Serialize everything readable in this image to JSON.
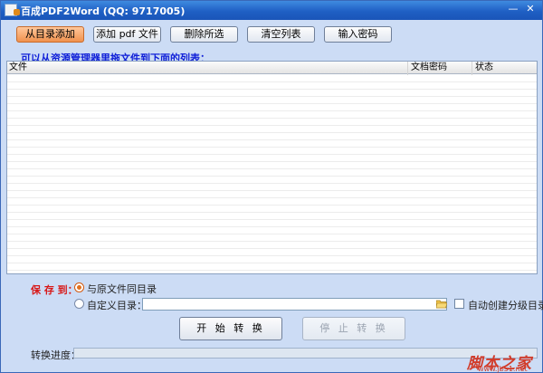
{
  "window": {
    "title": "百成PDF2Word (QQ: 9717005)",
    "minimize_glyph": "—",
    "close_glyph": "✕"
  },
  "toolbar": {
    "buttons": [
      {
        "label": "从目录添加",
        "active": true
      },
      {
        "label": "添加 pdf 文件",
        "active": false
      },
      {
        "label": "删除所选",
        "active": false
      },
      {
        "label": "清空列表",
        "active": false
      },
      {
        "label": "输入密码",
        "active": false
      }
    ]
  },
  "hint": "可以从资源管理器里拖文件到下面的列表：",
  "file_list": {
    "columns": [
      "文件",
      "文档密码",
      "状态"
    ],
    "rows": []
  },
  "save_to": {
    "label": "保 存 到：",
    "option_same_dir": "与原文件同目录",
    "option_custom_dir": "自定义目录：",
    "selected": "same_dir",
    "custom_dir_value": "",
    "auto_subdir_label": "自动创建分级目录",
    "auto_subdir_checked": false
  },
  "actions": {
    "start_label": "开 始 转 换",
    "stop_label": "停 止 转 换"
  },
  "progress": {
    "label": "转换进度：",
    "value_percent": 0
  },
  "watermark": {
    "text": "脚本之家",
    "url": "www.jb51.net"
  },
  "colors": {
    "window_bg": "#ccdcf5",
    "titlebar": "#1f5fc4",
    "active_button": "#f0914f",
    "hint_text": "#1020d8",
    "save_label": "#d81818",
    "watermark": "#d23c2a"
  },
  "icons": {
    "app": "pdf-word-icon",
    "browse": "folder-icon"
  }
}
